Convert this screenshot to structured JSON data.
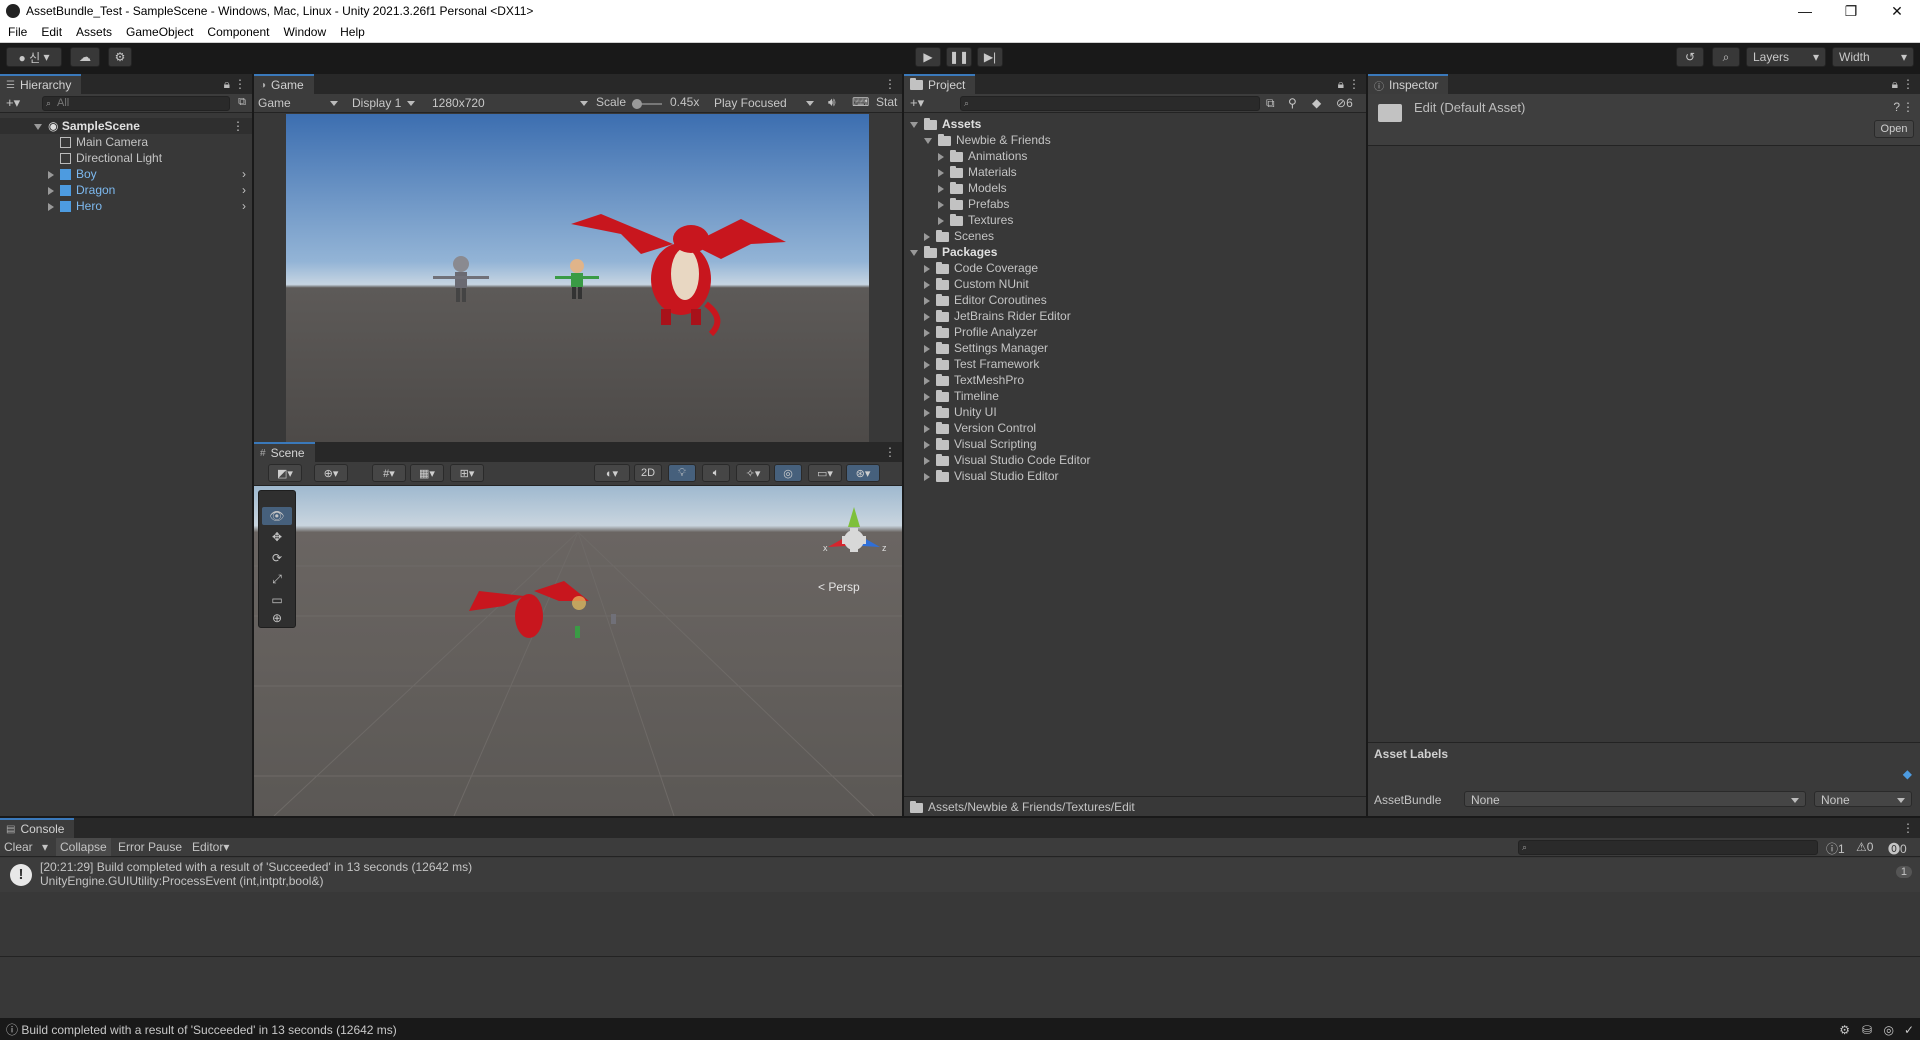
{
  "window": {
    "title": "AssetBundle_Test - SampleScene - Windows, Mac, Linux - Unity 2021.3.26f1 Personal <DX11>",
    "minimize": "—",
    "restore": "❐",
    "close": "✕"
  },
  "menu": [
    "File",
    "Edit",
    "Assets",
    "GameObject",
    "Component",
    "Window",
    "Help"
  ],
  "toolbar": {
    "account": "● 신",
    "layers_label": "Layers",
    "layout_label": "Width"
  },
  "hierarchy": {
    "tab": "Hierarchy",
    "search_placeholder": "All",
    "scene": "SampleScene",
    "items": [
      {
        "label": "Main Camera"
      },
      {
        "label": "Directional Light"
      },
      {
        "label": "Boy"
      },
      {
        "label": "Dragon"
      },
      {
        "label": "Hero"
      }
    ]
  },
  "game": {
    "tab": "Game",
    "mode": "Game",
    "display": "Display 1",
    "resolution": "1280x720",
    "scale_label": "Scale",
    "scale_value": "0.45x",
    "play_mode": "Play Focused",
    "stats": "Stat"
  },
  "scene": {
    "tab": "Scene",
    "btn_2d": "2D",
    "persp": "< Persp",
    "axis_x": "x",
    "axis_z": "z"
  },
  "project": {
    "tab": "Project",
    "hidden_count": "6",
    "tree": [
      {
        "label": "Assets",
        "depth": 0,
        "open": true,
        "bold": true
      },
      {
        "label": "Newbie & Friends",
        "depth": 1,
        "open": true
      },
      {
        "label": "Animations",
        "depth": 2
      },
      {
        "label": "Materials",
        "depth": 2
      },
      {
        "label": "Models",
        "depth": 2
      },
      {
        "label": "Prefabs",
        "depth": 2
      },
      {
        "label": "Textures",
        "depth": 2
      },
      {
        "label": "Scenes",
        "depth": 1
      },
      {
        "label": "Packages",
        "depth": 0,
        "open": true,
        "bold": true
      },
      {
        "label": "Code Coverage",
        "depth": 1
      },
      {
        "label": "Custom NUnit",
        "depth": 1
      },
      {
        "label": "Editor Coroutines",
        "depth": 1
      },
      {
        "label": "JetBrains Rider Editor",
        "depth": 1
      },
      {
        "label": "Profile Analyzer",
        "depth": 1
      },
      {
        "label": "Settings Manager",
        "depth": 1
      },
      {
        "label": "Test Framework",
        "depth": 1
      },
      {
        "label": "TextMeshPro",
        "depth": 1
      },
      {
        "label": "Timeline",
        "depth": 1
      },
      {
        "label": "Unity UI",
        "depth": 1
      },
      {
        "label": "Version Control",
        "depth": 1
      },
      {
        "label": "Visual Scripting",
        "depth": 1
      },
      {
        "label": "Visual Studio Code Editor",
        "depth": 1
      },
      {
        "label": "Visual Studio Editor",
        "depth": 1
      }
    ],
    "path": "Assets/Newbie & Friends/Textures/Edit"
  },
  "inspector": {
    "tab": "Inspector",
    "asset_title": "Edit (Default Asset)",
    "open_btn": "Open",
    "asset_labels": "Asset Labels",
    "assetbundle_label": "AssetBundle",
    "bundle_value": "None",
    "variant_value": "None"
  },
  "console": {
    "tab": "Console",
    "clear": "Clear",
    "collapse": "Collapse",
    "error_pause": "Error Pause",
    "editor": "Editor",
    "count_info": "1",
    "count_warn": "0",
    "count_error": "0",
    "message_line1": "[20:21:29] Build completed with a result of 'Succeeded' in 13 seconds (12642 ms)",
    "message_line2": "UnityEngine.GUIUtility:ProcessEvent (int,intptr,bool&)",
    "message_count": "1"
  },
  "status": {
    "text": "Build completed with a result of 'Succeeded' in 13 seconds (12642 ms)"
  },
  "colors": {
    "accent": "#3a79bb",
    "panel": "#383838",
    "dragon": "#c8161e"
  }
}
